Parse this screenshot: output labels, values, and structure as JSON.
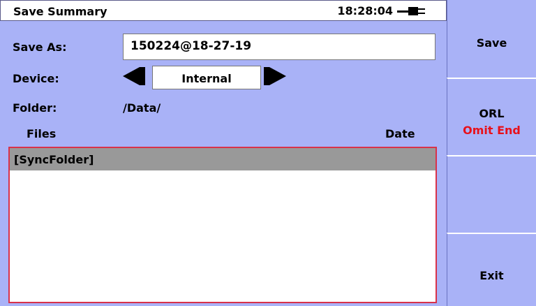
{
  "title": "Save Summary",
  "clock": "18:28:04",
  "form": {
    "save_as_label": "Save As:",
    "save_as_value": "150224@18-27-19",
    "device_label": "Device:",
    "device_value": "Internal",
    "folder_label": "Folder:",
    "folder_value": "/Data/"
  },
  "list": {
    "col_files": "Files",
    "col_date": "Date",
    "rows": [
      {
        "name": "[SyncFolder]",
        "date": ""
      }
    ]
  },
  "softkeys": {
    "save": "Save",
    "orl_line1": "ORL",
    "orl_line2": "Omit End",
    "empty": "",
    "exit": "Exit"
  },
  "colors": {
    "background": "#a9b2f7",
    "list_border": "#d8324a",
    "selected_row": "#999999",
    "warning_text": "#e8101a"
  }
}
